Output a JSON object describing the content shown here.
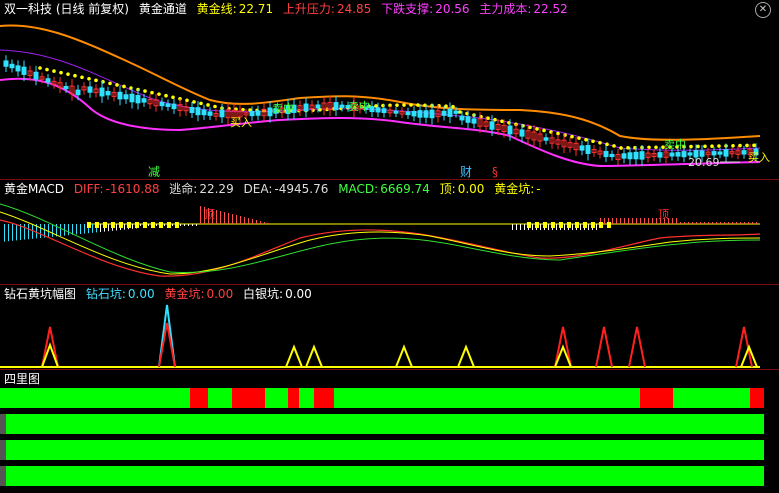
{
  "main": {
    "title": "双一科技 (日线 前复权)",
    "indicator_name": "黄金通道",
    "items": [
      {
        "label": "黄金线:",
        "value": "22.71",
        "color": "#ffff00"
      },
      {
        "label": "上升压力:",
        "value": "24.85",
        "color": "#ff4040"
      },
      {
        "label": "下跌支撑:",
        "value": "20.56",
        "color": "#ff40ff"
      },
      {
        "label": "主力成本:",
        "value": "22.52",
        "color": "#ff40ff"
      }
    ],
    "annotations": {
      "buy": "买入",
      "sell_mid": "卖中",
      "reduce": "减",
      "cai": "财",
      "s_mark": "§",
      "low_price": "20.69"
    }
  },
  "macd": {
    "title": "黄金MACD",
    "diff": {
      "label": "DIFF:",
      "value": "-1610.88",
      "color": "#ff4040"
    },
    "escape": {
      "label": "逃命:",
      "value": "22.29",
      "color": "#dddddd"
    },
    "dea": {
      "label": "DEA:",
      "value": "-4945.76",
      "color": "#dddddd"
    },
    "macd": {
      "label": "MACD:",
      "value": "6669.74",
      "color": "#40ff40"
    },
    "top": {
      "label": "顶:",
      "value": "0.00",
      "color": "#ffff00"
    },
    "pit": {
      "label": "黄金坑:",
      "value": "-",
      "color": "#ffff00"
    },
    "annotation": "顶"
  },
  "pit": {
    "title": "钻石黄坑幅图",
    "diamond": {
      "label": "钻石坑:",
      "value": "0.00",
      "color": "#40e0ff"
    },
    "gold": {
      "label": "黄金坑:",
      "value": "0.00",
      "color": "#ff4040"
    },
    "silver": {
      "label": "白银坑:",
      "value": "0.00",
      "color": "#ffffff"
    }
  },
  "four": {
    "title": "四里图"
  },
  "colors": {
    "up": "#ff3030",
    "down": "#30e0ff",
    "upper_band": "#ff8c00",
    "lower_band": "#ff30ff",
    "dots": "#ffff00",
    "green": "#00ff00",
    "red": "#ff0000"
  }
}
